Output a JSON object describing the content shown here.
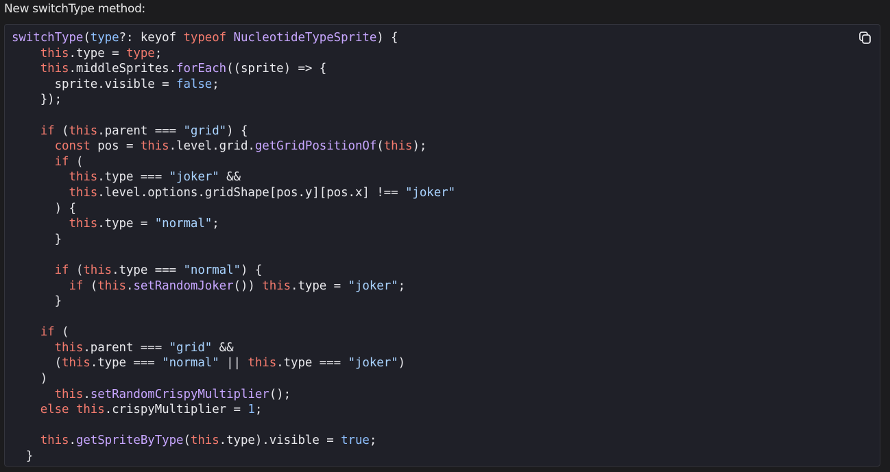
{
  "heading": "New switchType method:",
  "copy_button": {
    "icon": "copy-icon"
  },
  "colors": {
    "background": "#1c1c1e",
    "code_background": "#1f2028",
    "function": "#c7a6ff",
    "keyword": "#f47b6e",
    "string": "#a9d3ff",
    "literal": "#8ec0ff",
    "plain": "#e8e8ec"
  },
  "code_lines": [
    [
      [
        "func",
        "switchType"
      ],
      [
        "plain",
        "("
      ],
      [
        "param",
        "type"
      ],
      [
        "plain",
        "?: keyof "
      ],
      [
        "kw",
        "typeof"
      ],
      [
        "plain",
        " "
      ],
      [
        "type",
        "NucleotideTypeSprite"
      ],
      [
        "plain",
        ") {"
      ]
    ],
    [
      [
        "plain",
        "    "
      ],
      [
        "this",
        "this"
      ],
      [
        "plain",
        ".type = "
      ],
      [
        "kw",
        "type"
      ],
      [
        "plain",
        ";"
      ]
    ],
    [
      [
        "plain",
        "    "
      ],
      [
        "this",
        "this"
      ],
      [
        "plain",
        ".middleSprites."
      ],
      [
        "func",
        "forEach"
      ],
      [
        "plain",
        "((sprite) => {"
      ]
    ],
    [
      [
        "plain",
        "      sprite.visible = "
      ],
      [
        "bool",
        "false"
      ],
      [
        "plain",
        ";"
      ]
    ],
    [
      [
        "plain",
        "    });"
      ]
    ],
    [
      [
        "plain",
        ""
      ]
    ],
    [
      [
        "plain",
        "    "
      ],
      [
        "kw",
        "if"
      ],
      [
        "plain",
        " ("
      ],
      [
        "this",
        "this"
      ],
      [
        "plain",
        ".parent === "
      ],
      [
        "str",
        "\"grid\""
      ],
      [
        "plain",
        ") {"
      ]
    ],
    [
      [
        "plain",
        "      "
      ],
      [
        "kw",
        "const"
      ],
      [
        "plain",
        " pos = "
      ],
      [
        "this",
        "this"
      ],
      [
        "plain",
        ".level.grid."
      ],
      [
        "func",
        "getGridPositionOf"
      ],
      [
        "plain",
        "("
      ],
      [
        "this",
        "this"
      ],
      [
        "plain",
        ");"
      ]
    ],
    [
      [
        "plain",
        "      "
      ],
      [
        "kw",
        "if"
      ],
      [
        "plain",
        " ("
      ]
    ],
    [
      [
        "plain",
        "        "
      ],
      [
        "this",
        "this"
      ],
      [
        "plain",
        ".type === "
      ],
      [
        "str",
        "\"joker\""
      ],
      [
        "plain",
        " &&"
      ]
    ],
    [
      [
        "plain",
        "        "
      ],
      [
        "this",
        "this"
      ],
      [
        "plain",
        ".level.options.gridShape[pos.y][pos.x] !== "
      ],
      [
        "str",
        "\"joker\""
      ]
    ],
    [
      [
        "plain",
        "      ) {"
      ]
    ],
    [
      [
        "plain",
        "        "
      ],
      [
        "this",
        "this"
      ],
      [
        "plain",
        ".type = "
      ],
      [
        "str",
        "\"normal\""
      ],
      [
        "plain",
        ";"
      ]
    ],
    [
      [
        "plain",
        "      }"
      ]
    ],
    [
      [
        "plain",
        ""
      ]
    ],
    [
      [
        "plain",
        "      "
      ],
      [
        "kw",
        "if"
      ],
      [
        "plain",
        " ("
      ],
      [
        "this",
        "this"
      ],
      [
        "plain",
        ".type === "
      ],
      [
        "str",
        "\"normal\""
      ],
      [
        "plain",
        ") {"
      ]
    ],
    [
      [
        "plain",
        "        "
      ],
      [
        "kw",
        "if"
      ],
      [
        "plain",
        " ("
      ],
      [
        "this",
        "this"
      ],
      [
        "plain",
        "."
      ],
      [
        "func",
        "setRandomJoker"
      ],
      [
        "plain",
        "()) "
      ],
      [
        "this",
        "this"
      ],
      [
        "plain",
        ".type = "
      ],
      [
        "str",
        "\"joker\""
      ],
      [
        "plain",
        ";"
      ]
    ],
    [
      [
        "plain",
        "      }"
      ]
    ],
    [
      [
        "plain",
        ""
      ]
    ],
    [
      [
        "plain",
        "    "
      ],
      [
        "kw",
        "if"
      ],
      [
        "plain",
        " ("
      ]
    ],
    [
      [
        "plain",
        "      "
      ],
      [
        "this",
        "this"
      ],
      [
        "plain",
        ".parent === "
      ],
      [
        "str",
        "\"grid\""
      ],
      [
        "plain",
        " &&"
      ]
    ],
    [
      [
        "plain",
        "      ("
      ],
      [
        "this",
        "this"
      ],
      [
        "plain",
        ".type === "
      ],
      [
        "str",
        "\"normal\""
      ],
      [
        "plain",
        " || "
      ],
      [
        "this",
        "this"
      ],
      [
        "plain",
        ".type === "
      ],
      [
        "str",
        "\"joker\""
      ],
      [
        "plain",
        ")"
      ]
    ],
    [
      [
        "plain",
        "    )"
      ]
    ],
    [
      [
        "plain",
        "      "
      ],
      [
        "this",
        "this"
      ],
      [
        "plain",
        "."
      ],
      [
        "func",
        "setRandomCrispyMultiplier"
      ],
      [
        "plain",
        "();"
      ]
    ],
    [
      [
        "plain",
        "    "
      ],
      [
        "kw",
        "else"
      ],
      [
        "plain",
        " "
      ],
      [
        "this",
        "this"
      ],
      [
        "plain",
        ".crispyMultiplier = "
      ],
      [
        "num",
        "1"
      ],
      [
        "plain",
        ";"
      ]
    ],
    [
      [
        "plain",
        ""
      ]
    ],
    [
      [
        "plain",
        "    "
      ],
      [
        "this",
        "this"
      ],
      [
        "plain",
        "."
      ],
      [
        "func",
        "getSpriteByType"
      ],
      [
        "plain",
        "("
      ],
      [
        "this",
        "this"
      ],
      [
        "plain",
        ".type).visible = "
      ],
      [
        "bool",
        "true"
      ],
      [
        "plain",
        ";"
      ]
    ],
    [
      [
        "plain",
        "  }"
      ]
    ]
  ]
}
